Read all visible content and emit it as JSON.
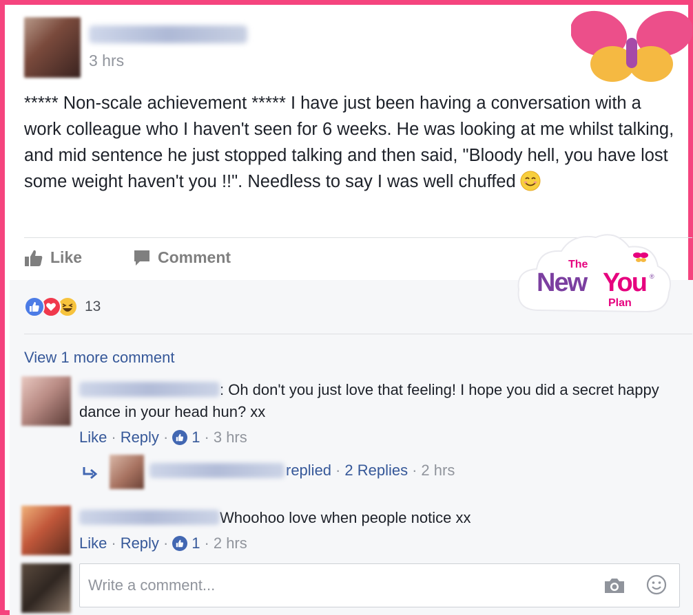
{
  "post": {
    "time": "3 hrs",
    "text": "***** Non-scale achievement ***** I have just been having a conversation with a work colleague who I haven't seen for 6 weeks. He was looking at me whilst talking, and mid sentence he just stopped talking and then said, \"Bloody hell, you have lost some weight haven't you !!\". Needless to say I was well chuffed",
    "emoji_icon": "smiling-face-icon"
  },
  "actions": {
    "like_label": "Like",
    "comment_label": "Comment"
  },
  "brand": {
    "logo_the": "The",
    "logo_new": "New",
    "logo_you": "You",
    "logo_reg": "®",
    "logo_plan": "Plan",
    "colors": {
      "frame": "#f5447e",
      "butterfly_pink": "#ec4f8a",
      "butterfly_yellow": "#f5b942",
      "logo_purple": "#7b3fa0",
      "logo_pink": "#e6007e"
    }
  },
  "reactions": {
    "icons": [
      "like-reaction-icon",
      "love-reaction-icon",
      "haha-reaction-icon"
    ],
    "count": "13"
  },
  "view_more": "View 1 more comment",
  "comments": [
    {
      "text": ": Oh don't you just love that feeling! I hope you did a secret happy dance in your head hun? xx",
      "like_label": "Like",
      "reply_label": "Reply",
      "likes": "1",
      "time": "3 hrs"
    },
    {
      "text": "Whoohoo love when people notice xx",
      "like_label": "Like",
      "reply_label": "Reply",
      "likes": "1",
      "time": "2 hrs"
    }
  ],
  "reply_summary": {
    "replied": "replied",
    "replies": "2 Replies",
    "time": "2 hrs"
  },
  "composer": {
    "placeholder": "Write a comment..."
  },
  "separator": "·"
}
